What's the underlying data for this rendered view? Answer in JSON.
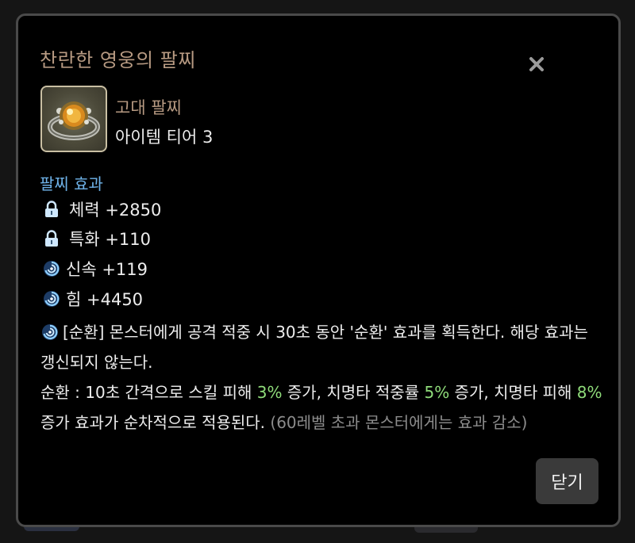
{
  "dialog": {
    "title": "찬란한 영웅의 팔찌",
    "close_button_label": "닫기"
  },
  "item": {
    "grade": "고대 팔찌",
    "tier": "아이템 티어 3"
  },
  "effects": {
    "section_title": "팔찌 효과",
    "stats": [
      {
        "icon": "lock-icon",
        "text": "체력 +2850"
      },
      {
        "icon": "lock-icon",
        "text": "특화 +110"
      },
      {
        "icon": "swirl-icon",
        "text": "신속 +119"
      },
      {
        "icon": "swirl-icon",
        "text": "힘 +4450"
      }
    ],
    "special": {
      "icon": "swirl-icon",
      "description": "[순환] 몬스터에게 공격 적중 시 30초 동안 '순환' 효과를 획득한다. 해당 효과는 갱신되지 않는다.",
      "detail_part1": "순환 : 10초 간격으로 스킬 피해 ",
      "value1": "3%",
      "detail_part2": " 증가, 치명타 적중률 ",
      "value2": "5%",
      "detail_part3": " 증가, 치명타 피해 ",
      "value3": "8%",
      "detail_part4": " 증가 효과가 순차적으로 적용된다. ",
      "note": "(60레벨 초과 몬스터에게는 효과 감소)"
    }
  },
  "colors": {
    "title": "#b79a82",
    "section": "#6fb3ea",
    "highlight": "#8fdc7a",
    "muted": "#8c8c8c"
  }
}
